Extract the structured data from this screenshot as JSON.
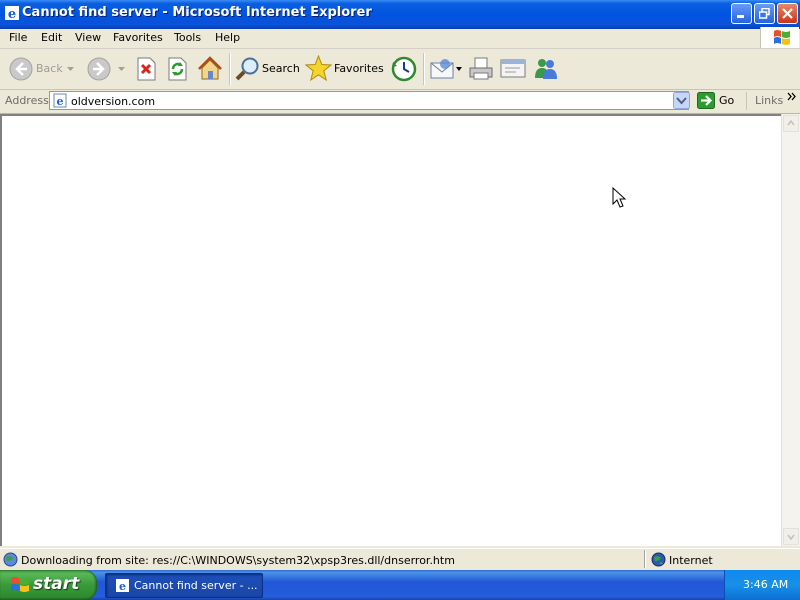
{
  "window": {
    "title": "Cannot find server - Microsoft Internet Explorer"
  },
  "menu": {
    "items": [
      "File",
      "Edit",
      "View",
      "Favorites",
      "Tools",
      "Help"
    ]
  },
  "toolbar": {
    "back_label": "Back",
    "search_label": "Search",
    "favorites_label": "Favorites"
  },
  "address": {
    "label": "Address",
    "value": "oldversion.com",
    "go_label": "Go",
    "links_label": "Links"
  },
  "status": {
    "text": "Downloading from site: res://C:\\WINDOWS\\system32\\xpsp3res.dll/dnserror.htm",
    "zone": "Internet"
  },
  "taskbar": {
    "start_label": "start",
    "task_label": "Cannot find server - ...",
    "clock": "3:46 AM"
  },
  "colors": {
    "titlebar": "#0054e3",
    "taskbar": "#245edb",
    "start": "#3a9a3a",
    "chrome": "#ece9d8"
  }
}
